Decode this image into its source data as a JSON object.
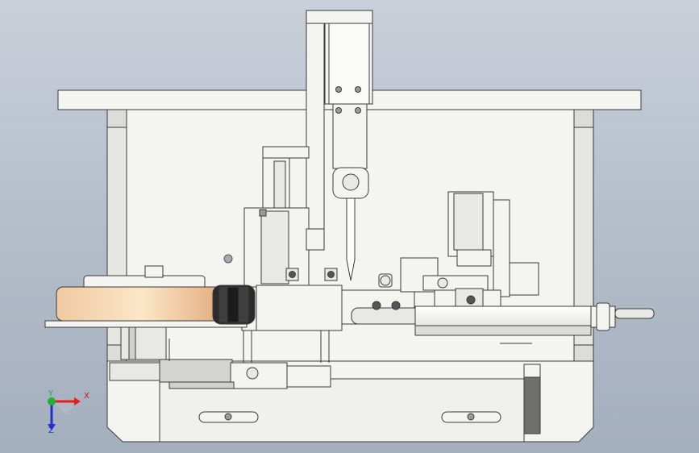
{
  "viewport": {
    "background_top": "#c9d0da",
    "background_bottom": "#a4afbe"
  },
  "model": {
    "part_fill": "#f4f4f1",
    "part_stroke": "#3a3a3a",
    "shade_fill": "#d9d9d6",
    "dark_fill": "#6e6e6a",
    "roller_color": "#e9b98a"
  },
  "triad": {
    "x_label": "X",
    "y_label": "Y",
    "z_label": "Z",
    "x_color": "#e02020",
    "y_color": "#20b030",
    "z_color": "#2030d0"
  }
}
